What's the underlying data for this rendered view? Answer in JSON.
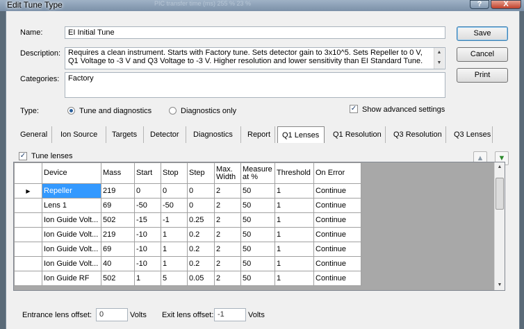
{
  "window": {
    "title": "Edit Tune Type",
    "ghost_title": "PIC transfer time (ms)    255   %        23   %",
    "help_label": "?",
    "close_label": "X"
  },
  "name": {
    "label": "Name:",
    "value": "EI Initial Tune"
  },
  "description": {
    "label": "Description:",
    "value": "Requires a clean instrument. Starts with Factory tune. Sets detector gain to 3x10^5. Sets Repeller to 0 V, Q1 Voltage to -3 V and Q3 Voltage to -3 V. Higher resolution and lower sensitivity than EI Standard Tune."
  },
  "categories": {
    "label": "Categories:",
    "value": "Factory"
  },
  "buttons": {
    "save": "Save",
    "cancel": "Cancel",
    "print": "Print"
  },
  "type": {
    "label": "Type:",
    "option_tune": "Tune and diagnostics",
    "option_diag": "Diagnostics only",
    "selected": "Tune and diagnostics"
  },
  "advanced": {
    "label": "Show advanced settings",
    "checked": true
  },
  "tabs": [
    "General",
    "Ion Source",
    "Targets",
    "Detector",
    "Diagnostics",
    "Report",
    "Q1 Lenses",
    "Q1 Resolution",
    "Q3 Resolution",
    "Q3 Lenses"
  ],
  "active_tab": "Q1 Lenses",
  "tune_lenses": {
    "label": "Tune lenses",
    "checked": true
  },
  "grid": {
    "columns": [
      "Device",
      "Mass",
      "Start",
      "Stop",
      "Step",
      "Max. Width",
      "Measure at %",
      "Threshold",
      "On Error"
    ],
    "rows": [
      [
        "Repeller",
        "219",
        "0",
        "0",
        "0",
        "2",
        "50",
        "1",
        "Continue"
      ],
      [
        "Lens 1",
        "69",
        "-50",
        "-50",
        "0",
        "2",
        "50",
        "1",
        "Continue"
      ],
      [
        "Ion Guide Volt...",
        "502",
        "-15",
        "-1",
        "0.25",
        "2",
        "50",
        "1",
        "Continue"
      ],
      [
        "Ion Guide Volt...",
        "219",
        "-10",
        "1",
        "0.2",
        "2",
        "50",
        "1",
        "Continue"
      ],
      [
        "Ion Guide Volt...",
        "69",
        "-10",
        "1",
        "0.2",
        "2",
        "50",
        "1",
        "Continue"
      ],
      [
        "Ion Guide Volt...",
        "40",
        "-10",
        "1",
        "0.2",
        "2",
        "50",
        "1",
        "Continue"
      ],
      [
        "Ion Guide RF",
        "502",
        "1",
        "5",
        "0.05",
        "2",
        "50",
        "1",
        "Continue"
      ]
    ]
  },
  "entrance_offset": {
    "label": "Entrance lens offset:",
    "value": "0",
    "unit": "Volts"
  },
  "exit_offset": {
    "label": "Exit lens offset:",
    "value": "-1",
    "unit": "Volts"
  },
  "colors": {
    "selection": "#3399ff",
    "accent": "#3c7fb1",
    "titlebar": "#8aa0b8"
  }
}
